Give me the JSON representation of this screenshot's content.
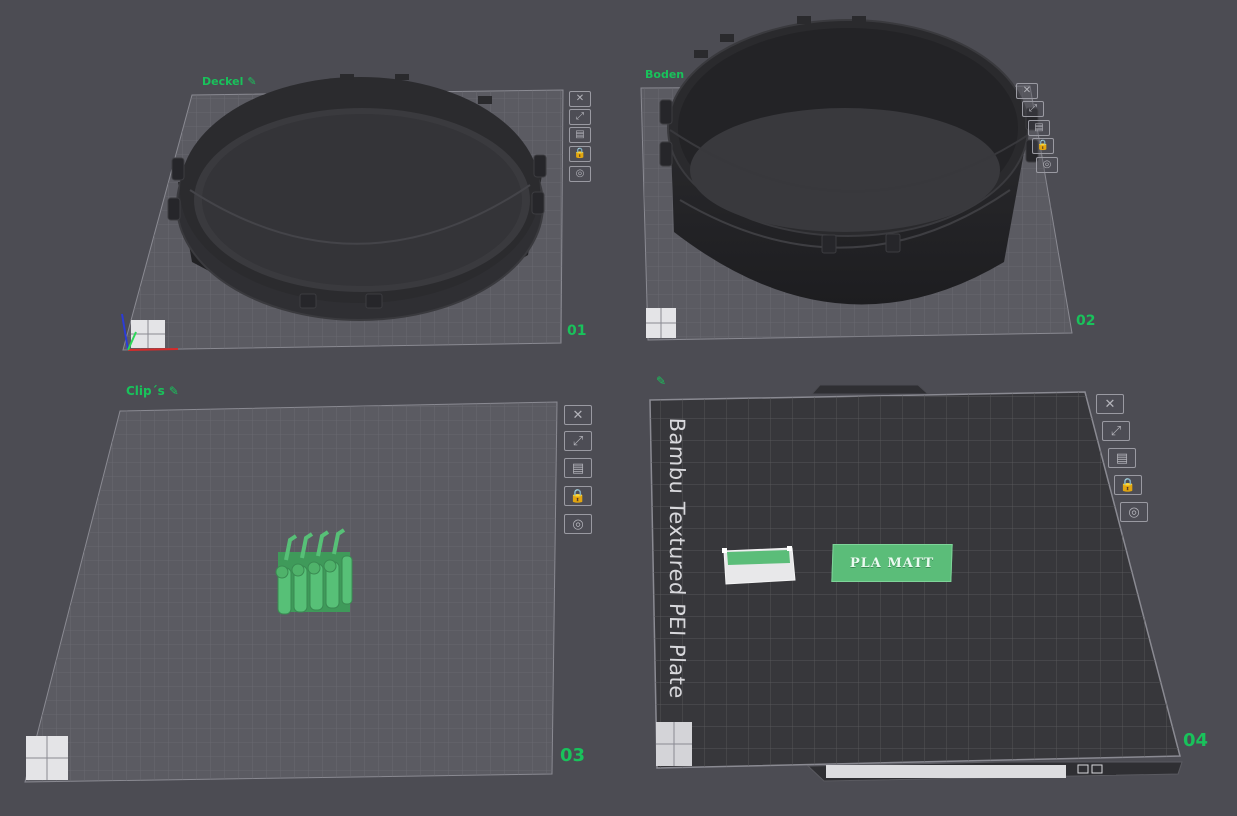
{
  "plates": [
    {
      "name": "Deckel",
      "number": "01"
    },
    {
      "name": "Boden",
      "number": "02"
    },
    {
      "name": "Clip´s",
      "number": "03"
    },
    {
      "name": "",
      "number": "04"
    }
  ],
  "plate_tools": {
    "delete": "✕",
    "arrange": "⤢",
    "orient": "▤",
    "lock": "🔒",
    "settings": "◎"
  },
  "bed": {
    "label": "Bambu Textured PEI Plate",
    "filament_badge": "PLA MATT"
  },
  "colors": {
    "background": "#4c4c53",
    "accent": "#19c25b",
    "model_black": "#2b2b2e",
    "clip_green": "#4fb26a"
  }
}
